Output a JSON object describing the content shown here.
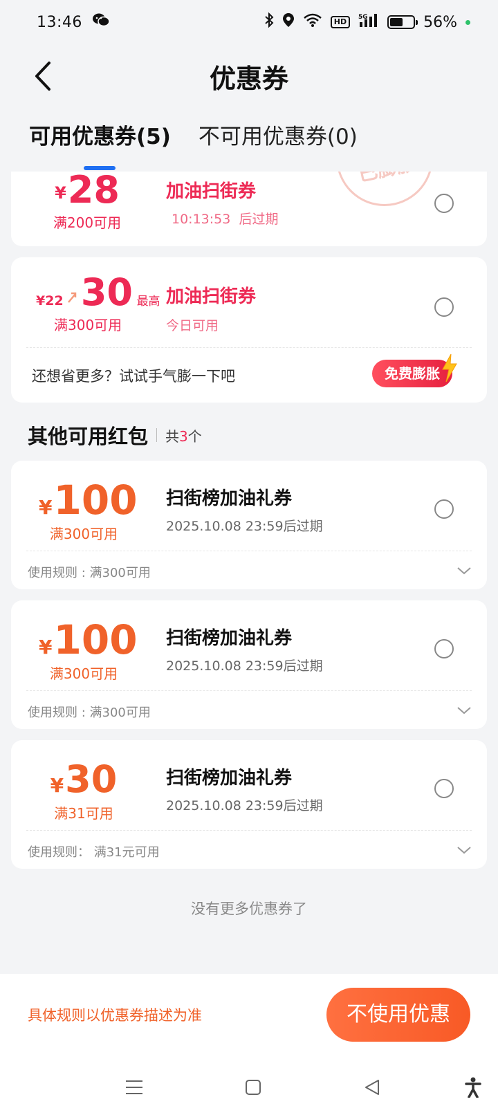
{
  "status_bar": {
    "time": "13:46",
    "battery_percent": "56%",
    "battery_level": 0.56,
    "hd": "HD",
    "network": "5G"
  },
  "header": {
    "title": "优惠券"
  },
  "tabs": [
    {
      "label": "可用优惠券(5)",
      "active": true
    },
    {
      "label": "不可用优惠券(0)",
      "active": false
    }
  ],
  "featured_coupons": [
    {
      "currency": "¥",
      "amount": "28",
      "condition": "满200可用",
      "title": "加油扫街券",
      "countdown": "10:13:53",
      "countdown_suffix": "后过期",
      "stamp_text": "已膨胀"
    },
    {
      "original_amount": "¥22",
      "amount": "30",
      "max_label": "最高",
      "condition": "满300可用",
      "title": "加油扫街券",
      "validity": "今日可用",
      "boost_prompt": "还想省更多？试试手气膨一下吧",
      "boost_button": "免费膨胀"
    }
  ],
  "other_section": {
    "title": "其他可用红包",
    "count_prefix": "共",
    "count": "3",
    "count_suffix": "个"
  },
  "other_coupons": [
    {
      "currency": "¥",
      "amount": "100",
      "condition": "满300可用",
      "title": "扫街榜加油礼券",
      "expiry": "2025.10.08 23:59后过期",
      "rule": "使用规则 : 满300可用"
    },
    {
      "currency": "¥",
      "amount": "100",
      "condition": "满300可用",
      "title": "扫街榜加油礼券",
      "expiry": "2025.10.08 23:59后过期",
      "rule": "使用规则 : 满300可用"
    },
    {
      "currency": "¥",
      "amount": "30",
      "condition": "满31可用",
      "title": "扫街榜加油礼券",
      "expiry": "2025.10.08 23:59后过期",
      "rule": "使用规则： 满31元可用"
    }
  ],
  "footer_text": "没有更多优惠券了",
  "bottom_bar": {
    "note": "具体规则以优惠券描述为准",
    "button": "不使用优惠"
  },
  "colors": {
    "accent_red": "#ed2a55",
    "accent_orange": "#f0622a",
    "tab_indicator": "#1f6ff2"
  },
  "icons": [
    "back-arrow-icon",
    "wechat-icon",
    "bluetooth-icon",
    "location-icon",
    "wifi-icon",
    "signal-icon",
    "battery-icon",
    "radio-icon",
    "chevron-down-icon",
    "menu-icon",
    "home-icon",
    "back-triangle-icon",
    "accessibility-icon",
    "lightning-icon",
    "up-arrow-icon"
  ]
}
